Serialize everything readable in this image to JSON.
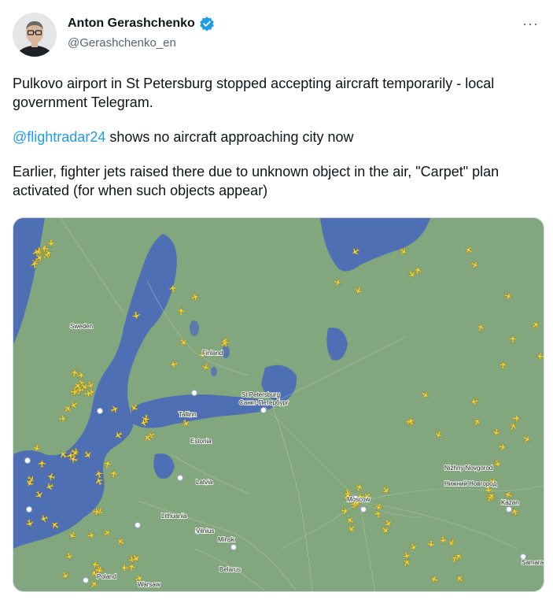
{
  "author": {
    "display_name": "Anton Gerashchenko",
    "handle": "@Gerashchenko_en",
    "verified": true,
    "verified_color": "#1d9bf0"
  },
  "menu_label": "···",
  "tweet": {
    "para1": "Pulkovo airport in St Petersburg stopped accepting aircraft temporarily - local government Telegram.",
    "mention": "@flightradar24",
    "para2_rest": " shows no aircraft approaching city now",
    "para3": "Earlier, fighter jets raised there due to unknown object in the air, \"Carpet\" plan activated (for when such objects appear)"
  },
  "map": {
    "labels": [
      "Sweden",
      "Finland",
      "St Petersburg",
      "Санкт-Петербург",
      "Tallinn",
      "Estonia",
      "Latvia",
      "Lithuania",
      "Vilnius",
      "Minsk",
      "Belarus",
      "Moscow",
      "Nizhny Novgorod",
      "Нижний Новгород",
      "Kazan",
      "Samara",
      "Poland",
      "Warsaw"
    ],
    "colors": {
      "land": "#7fa37a",
      "water": "#4f6fb5",
      "plane": "#f4d43a"
    }
  }
}
